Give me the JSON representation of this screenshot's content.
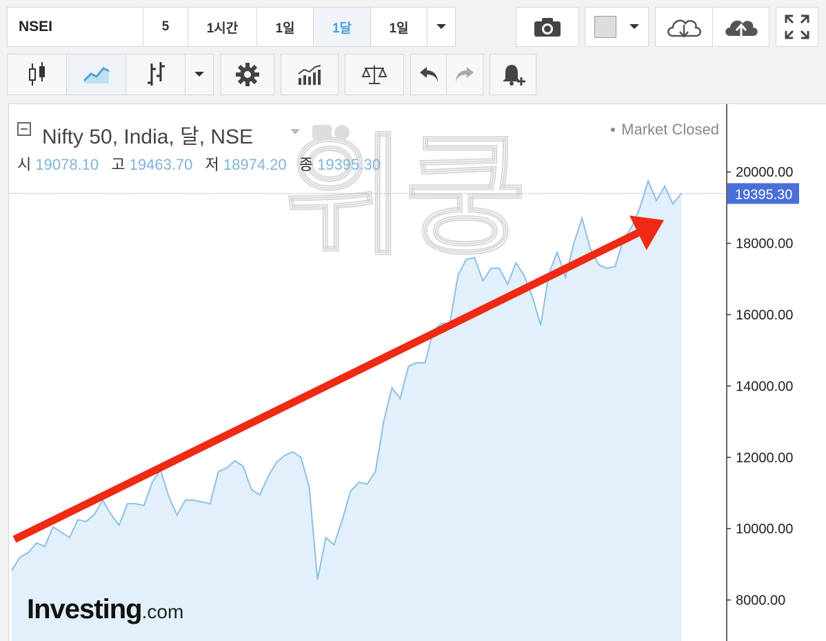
{
  "toolbar": {
    "symbol": "NSEI",
    "intervals": [
      "5",
      "1시간",
      "1일",
      "1달",
      "1일"
    ],
    "active_interval_index": 3
  },
  "toolbar2": {
    "icons": [
      "candlestick-icon",
      "line-chart-icon",
      "bar-chart-icon",
      "dropdown-icon",
      "settings-icon",
      "indicators-icon",
      "compare-icon",
      "undo-icon",
      "redo-icon",
      "alert-add-icon"
    ]
  },
  "header": {
    "title": "Nifty 50, India, 달, NSE",
    "market_status": "Market Closed",
    "ohlc": {
      "open_label": "시",
      "open": "19078.10",
      "high_label": "고",
      "high": "19463.70",
      "low_label": "저",
      "low": "18974.20",
      "close_label": "종",
      "close": "19395.30"
    }
  },
  "watermark_text": "위쿵",
  "logo": {
    "main": "Investing",
    "suffix": ".com"
  },
  "colors": {
    "line": "#8dbfe2",
    "fill": "#e1f0fa",
    "arrow": "#ee2a14",
    "price_tag": "#4a6fd6",
    "active": "#4aa3d9"
  },
  "chart_data": {
    "type": "area",
    "title": "Nifty 50, India, 달, NSE",
    "ylim": [
      6850,
      21900
    ],
    "y_ticks": [
      "20000.00",
      "18000.00",
      "16000.00",
      "14000.00",
      "12000.00",
      "10000.00",
      "8000.00"
    ],
    "y_tick_values": [
      20000,
      18000,
      16000,
      14000,
      12000,
      10000,
      8000
    ],
    "last_price": "19395.30",
    "last_price_value": 19395.3,
    "values": [
      8830,
      9200,
      9330,
      9600,
      9500,
      10050,
      9900,
      9750,
      10250,
      10200,
      10400,
      10800,
      10400,
      10100,
      10700,
      10700,
      10650,
      11300,
      11650,
      10900,
      10380,
      10800,
      10800,
      10750,
      10700,
      11600,
      11700,
      11900,
      11750,
      11100,
      10950,
      11450,
      11850,
      12050,
      12150,
      12000,
      11150,
      8570,
      9750,
      9550,
      10250,
      11050,
      11300,
      11250,
      11600,
      13000,
      13950,
      13650,
      14550,
      14650,
      14650,
      15550,
      15750,
      15750,
      17100,
      17550,
      17600,
      16950,
      17300,
      17300,
      16850,
      17450,
      17100,
      16500,
      15700,
      17150,
      17750,
      17050,
      18000,
      18700,
      17850,
      17400,
      17300,
      17350,
      18100,
      18450,
      19000,
      19750,
      19200,
      19600,
      19100,
      19400
    ],
    "trend_arrow": {
      "from_value": 9700,
      "to_value": 18650
    }
  }
}
